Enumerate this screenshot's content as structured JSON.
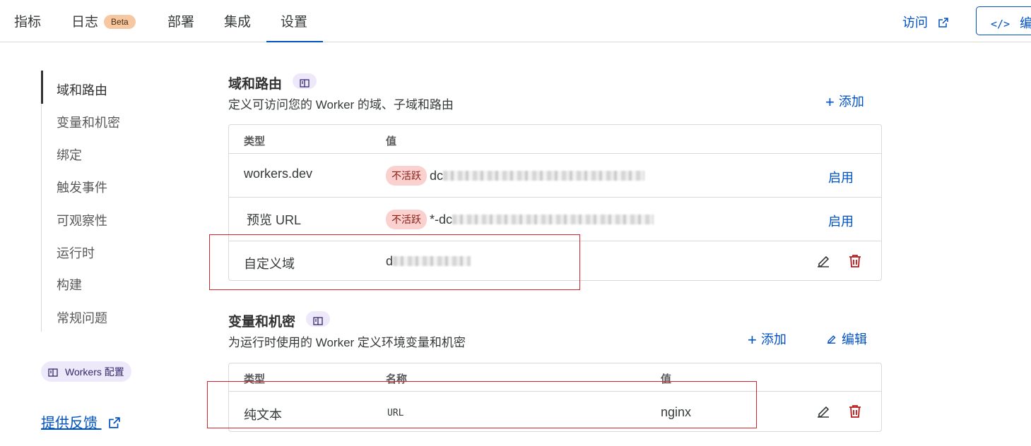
{
  "tabs": {
    "metrics": "指标",
    "logs": "日志",
    "beta": "Beta",
    "deploy": "部署",
    "integrations": "集成",
    "settings": "设置"
  },
  "header": {
    "visit": "访问",
    "edit": "编辑"
  },
  "nav": {
    "items": [
      "域和路由",
      "变量和机密",
      "绑定",
      "触发事件",
      "可观察性",
      "运行时",
      "构建",
      "常规问题"
    ],
    "docs_chip": "Workers 配置",
    "feedback": "提供反馈"
  },
  "domains": {
    "title": "域和路由",
    "subtitle": "定义可访问您的 Worker 的域、子域和路由",
    "add": "添加",
    "col_type": "类型",
    "col_value": "值",
    "rows": [
      {
        "type": "workers.dev",
        "status": "不活跃",
        "value_prefix": "dc",
        "action": "启用"
      },
      {
        "type": "预览 URL",
        "status": "不活跃",
        "value_prefix": "*-dc",
        "action": "启用"
      },
      {
        "type": "自定义域",
        "value_prefix": "d"
      }
    ]
  },
  "variables": {
    "title": "变量和机密",
    "subtitle": "为运行时使用的 Worker 定义环境变量和机密",
    "add": "添加",
    "edit": "编辑",
    "col_type": "类型",
    "col_name": "名称",
    "col_value": "值",
    "rows": [
      {
        "type": "纯文本",
        "name": "URL",
        "value": "nginx"
      }
    ]
  },
  "colors": {
    "accent": "#0051c3",
    "danger": "#b91c1c",
    "inactive_bg": "#fbd1cf",
    "annotation": "#d8232a"
  }
}
